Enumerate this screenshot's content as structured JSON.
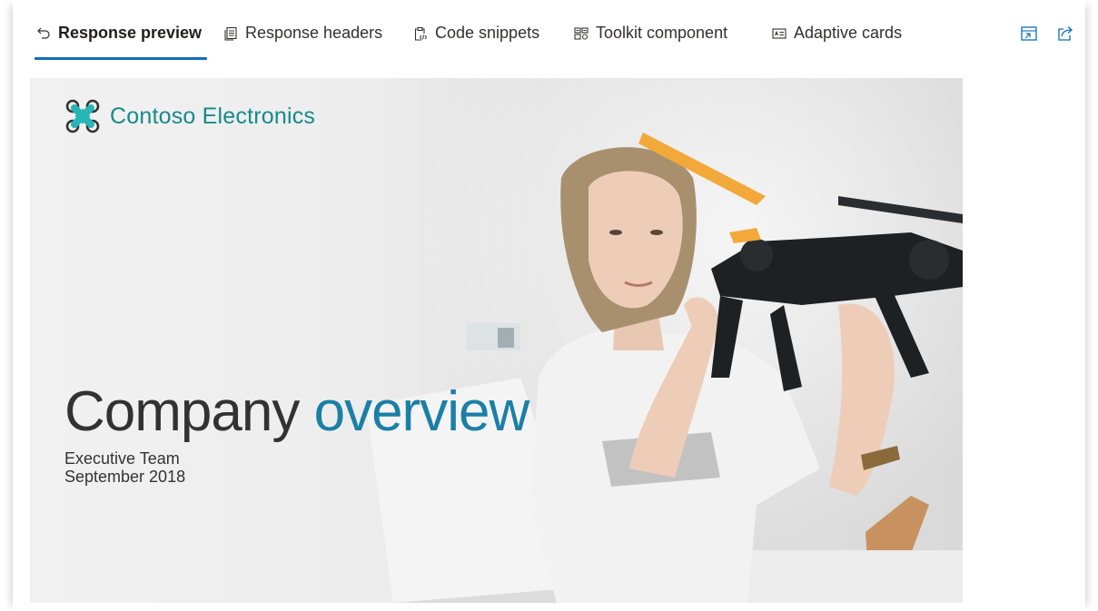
{
  "tabs": [
    {
      "label": "Response preview",
      "icon": "undo-arrow-icon",
      "active": true
    },
    {
      "label": "Response headers",
      "icon": "document-lines-icon",
      "active": false
    },
    {
      "label": "Code snippets",
      "icon": "clipboard-code-icon",
      "active": false
    },
    {
      "label": "Toolkit component",
      "icon": "toolkit-component-icon",
      "active": false
    },
    {
      "label": "Adaptive cards",
      "icon": "adaptive-card-icon",
      "active": false
    }
  ],
  "actions": {
    "expand_icon": "expand-window-icon",
    "share_icon": "share-icon"
  },
  "slide": {
    "brand": "Contoso Electronics",
    "headline_word1": "Company",
    "headline_word2": "overview",
    "subtitle_line1": "Executive Team",
    "subtitle_line2": "September 2018"
  },
  "colors": {
    "accent": "#0f6cbd",
    "brand_teal": "#168a8c",
    "headline_blue": "#1b7fa6",
    "headline_dark": "#323232"
  }
}
